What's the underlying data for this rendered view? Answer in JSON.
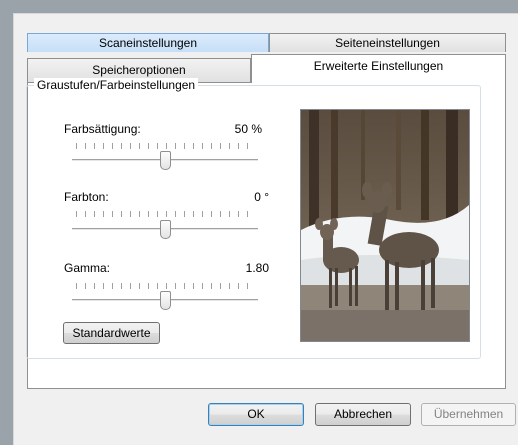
{
  "tabs": {
    "row_back": [
      "Scaneinstellungen",
      "Seiteneinstellungen"
    ],
    "row_front": [
      "Speicheroptionen",
      "Erweiterte Einstellungen"
    ],
    "active": "Erweiterte Einstellungen"
  },
  "group": {
    "title": "Graustufen/Farbeinstellungen"
  },
  "sliders": {
    "saturation": {
      "label": "Farbsättigung:",
      "value": "50 %",
      "level": 0.5
    },
    "hue": {
      "label": "Farbton:",
      "value": "0 °",
      "level": 0.5
    },
    "gamma": {
      "label": "Gamma:",
      "value": "1.80",
      "level": 0.5
    }
  },
  "defaults_button": "Standardwerte",
  "preview": {
    "subject": "deer-photo",
    "alt": "two deer in snowy forest"
  },
  "buttons": {
    "ok": "OK",
    "cancel": "Abbrechen",
    "apply": "Übernehmen"
  },
  "colors": {
    "selected_tab": "#c6dff8",
    "default_button_border": "#3c7fb1"
  }
}
